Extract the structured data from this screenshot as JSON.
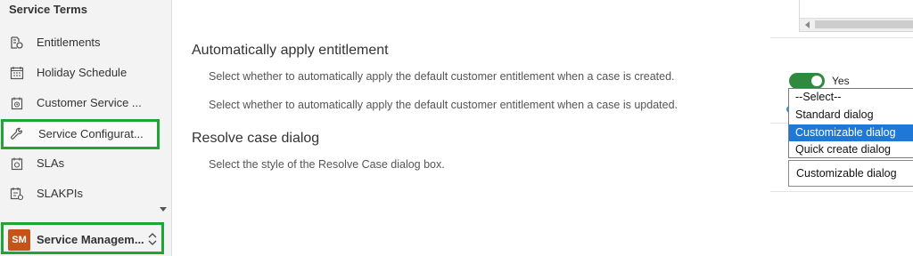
{
  "sidebar": {
    "section_title": "Service Terms",
    "items": [
      {
        "label": "Entitlements",
        "icon": "entitlements-icon"
      },
      {
        "label": "Holiday Schedule",
        "icon": "calendar-icon"
      },
      {
        "label": "Customer Service ...",
        "icon": "schedule-icon"
      },
      {
        "label": "Service Configurat...",
        "icon": "wrench-icon",
        "highlighted": true
      },
      {
        "label": "SLAs",
        "icon": "sla-icon"
      },
      {
        "label": "SLAKPIs",
        "icon": "sla-kpi-icon"
      }
    ],
    "area_switcher": {
      "avatar_initials": "SM",
      "label": "Service Managem...",
      "avatar_color": "#c5531a"
    },
    "highlight_color": "#1fa535"
  },
  "main": {
    "entitlement": {
      "heading": "Automatically apply entitlement",
      "desc_created": "Select whether to automatically apply the default customer entitlement when a case is created.",
      "desc_updated": "Select whether to automatically apply the default customer entitlement when a case is updated."
    },
    "resolve": {
      "heading": "Resolve case dialog",
      "desc": "Select the style of the Resolve Case dialog box."
    }
  },
  "right_panel": {
    "toggle": {
      "label": "Yes",
      "on": true,
      "color": "#2f8a3e"
    },
    "dropdown_options": [
      "--Select--",
      "Standard dialog",
      "Customizable dialog",
      "Quick create dialog"
    ],
    "dropdown_selected_index": 2,
    "select_value": "Customizable dialog",
    "selected_color": "#1e78d7"
  }
}
